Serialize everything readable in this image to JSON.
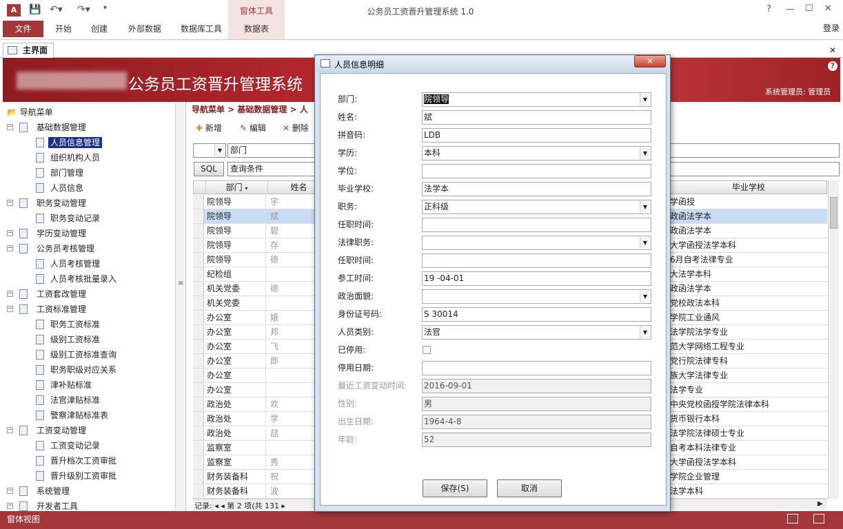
{
  "window": {
    "title": "公务员工资晋升管理系统 1.0",
    "login": "登录",
    "controls": [
      "?",
      "—",
      "☐",
      "✕"
    ]
  },
  "ribbon": {
    "file": "文件",
    "tabs": [
      "开始",
      "创建",
      "外部数据",
      "数据库工具"
    ],
    "context_header": "窗体工具",
    "context_tab": "数据表"
  },
  "doc_tab": {
    "label": "主界面",
    "close": "✕"
  },
  "banner": {
    "title": "公务员工资晋升管理系统",
    "user": "系统管理员: 管理员"
  },
  "sidebar": {
    "root": "导航菜单",
    "items": [
      {
        "label": "基础数据管理",
        "level": 1
      },
      {
        "label": "人员信息管理",
        "level": 2,
        "selected": true
      },
      {
        "label": "组织机构人员",
        "level": 2
      },
      {
        "label": "部门管理",
        "level": 2
      },
      {
        "label": "人员信息",
        "level": 2
      },
      {
        "label": "职务变动管理",
        "level": 1
      },
      {
        "label": "职务变动记录",
        "level": 2
      },
      {
        "label": "学历变动管理",
        "level": 1
      },
      {
        "label": "公务员考核管理",
        "level": 1
      },
      {
        "label": "人员考核管理",
        "level": 2
      },
      {
        "label": "人员考核批量录入",
        "level": 2
      },
      {
        "label": "工资套改管理",
        "level": 1
      },
      {
        "label": "工资标准管理",
        "level": 1
      },
      {
        "label": "职务工资标准",
        "level": 2
      },
      {
        "label": "级别工资标准",
        "level": 2
      },
      {
        "label": "级别工资标准查询",
        "level": 2
      },
      {
        "label": "职务职级对应关系",
        "level": 2
      },
      {
        "label": "津补贴标准",
        "level": 2
      },
      {
        "label": "法官津贴标准",
        "level": 2
      },
      {
        "label": "警察津贴标准表",
        "level": 2
      },
      {
        "label": "工资变动管理",
        "level": 1
      },
      {
        "label": "工资变动记录",
        "level": 2
      },
      {
        "label": "晋升档次工资审批",
        "level": 2
      },
      {
        "label": "晋升级别工资审批",
        "level": 2
      },
      {
        "label": "系统管理",
        "level": 1
      },
      {
        "label": "开发者工具",
        "level": 1
      }
    ]
  },
  "content": {
    "breadcrumb": "导航菜单 > 基础数据管理 > 人",
    "toolbar": {
      "new": "新增",
      "edit": "编辑",
      "delete": "删除"
    },
    "filter_field": "部门",
    "sql_button": "SQL",
    "query_label": "查询条件",
    "columns": {
      "dept": "部门",
      "name": "姓名",
      "school": "毕业学校"
    },
    "rows": [
      {
        "dept": "院领导",
        "name": "宇",
        "school": "学函授"
      },
      {
        "dept": "院领导",
        "name": "斌",
        "school": "政函法学本",
        "current": true
      },
      {
        "dept": "院领导",
        "name": "碧",
        "school": "政函法学本"
      },
      {
        "dept": "院领导",
        "name": "存",
        "school": "大学函授法学本科"
      },
      {
        "dept": "院领导",
        "name": "德",
        "school": "6月自考法律专业"
      },
      {
        "dept": "纪检组",
        "name": "",
        "school": "大法学本科"
      },
      {
        "dept": "机关党委",
        "name": "德",
        "school": "政函法学本"
      },
      {
        "dept": "机关党委",
        "name": "",
        "school": "党校政法本科"
      },
      {
        "dept": "办公室",
        "name": "娥",
        "school": "学院工业通风"
      },
      {
        "dept": "办公室",
        "name": "邦",
        "school": "法学院法学专业"
      },
      {
        "dept": "办公室",
        "name": "飞",
        "school": "范大学网络工程专业"
      },
      {
        "dept": "办公室",
        "name": "郎",
        "school": "党行院法律专科"
      },
      {
        "dept": "办公室",
        "name": "",
        "school": "族大学法律专业"
      },
      {
        "dept": "办公室",
        "name": "",
        "school": "法学专业"
      },
      {
        "dept": "政治处",
        "name": "欢",
        "school": "中央党校函授学院法律本科"
      },
      {
        "dept": "政治处",
        "name": "学",
        "school": "货币银行本科"
      },
      {
        "dept": "政治处",
        "name": "喆",
        "school": "法学院法律硕士专业"
      },
      {
        "dept": "监察室",
        "name": "",
        "school": "自考本科法律专业"
      },
      {
        "dept": "监察室",
        "name": "秀",
        "school": "大学函授法学本科"
      },
      {
        "dept": "财务装备科",
        "name": "祝",
        "school": "学院企业管理"
      },
      {
        "dept": "财务装备科",
        "name": "波",
        "school": "法学本科"
      }
    ],
    "record_nav": "记录: ◂ ◂ 第 2 项(共 131 ▸"
  },
  "status": {
    "left": "窗体视图"
  },
  "dialog": {
    "title": "人员信息明细",
    "close": "✕",
    "fields": [
      {
        "label": "部门:",
        "value": "院领导",
        "type": "select"
      },
      {
        "label": "姓名:",
        "value": "斌",
        "type": "text"
      },
      {
        "label": "拼音码:",
        "value": "LDB",
        "type": "text"
      },
      {
        "label": "学历:",
        "value": "本科",
        "type": "select"
      },
      {
        "label": "学位:",
        "value": "",
        "type": "text"
      },
      {
        "label": "毕业学校:",
        "value": "法学本",
        "type": "text"
      },
      {
        "label": "职务:",
        "value": "正科级",
        "type": "select"
      },
      {
        "label": "任职时间:",
        "value": "",
        "type": "text"
      },
      {
        "label": "法律职务:",
        "value": "",
        "type": "select"
      },
      {
        "label": "任职时间:",
        "value": "",
        "type": "text"
      },
      {
        "label": "参工时间:",
        "value": "19  -04-01",
        "type": "text"
      },
      {
        "label": "政治面貌:",
        "value": "",
        "type": "select"
      },
      {
        "label": "身份证号码:",
        "value": "S        30014",
        "type": "text"
      },
      {
        "label": "人员类别:",
        "value": "法官",
        "type": "select"
      },
      {
        "label": "已停用:",
        "value": "",
        "type": "checkbox"
      },
      {
        "label": "停用日期:",
        "value": "",
        "type": "text"
      },
      {
        "label": "最近工资变动时间:",
        "value": "2016-09-01",
        "type": "disabled"
      },
      {
        "label": "性别:",
        "value": "男",
        "type": "disabled"
      },
      {
        "label": "出生日期:",
        "value": "1964-4-8",
        "type": "disabled"
      },
      {
        "label": "年龄:",
        "value": "52",
        "type": "disabled"
      }
    ],
    "save": "保存(S)",
    "cancel": "取消"
  }
}
